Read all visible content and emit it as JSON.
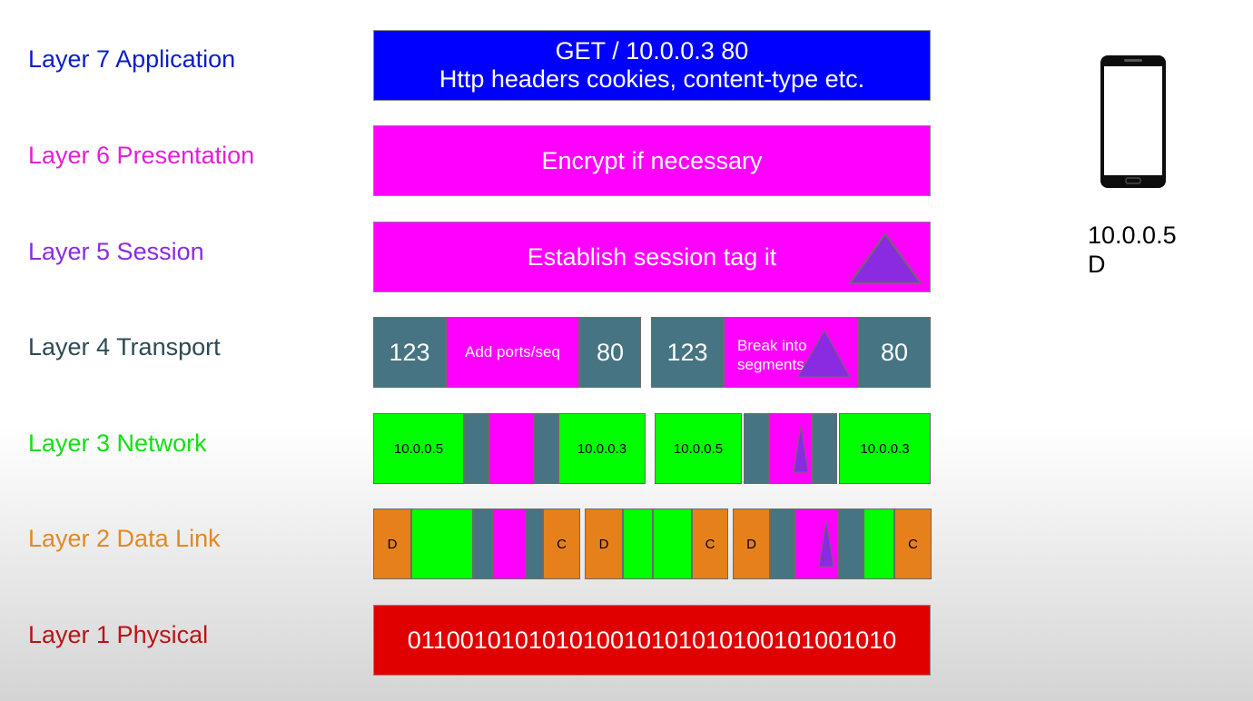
{
  "layers": [
    {
      "label": "Layer 7 Application",
      "color": "#0a1ec8"
    },
    {
      "label": "Layer 6 Presentation",
      "color": "#e41fd6"
    },
    {
      "label": "Layer 5 Session",
      "color": "#8a2be2"
    },
    {
      "label": "Layer 4 Transport",
      "color": "#2c4a55"
    },
    {
      "label": "Layer 3 Network",
      "color": "#14e014"
    },
    {
      "label": "Layer 2 Data Link",
      "color": "#e08a22"
    },
    {
      "label": "Layer 1 Physical",
      "color": "#b81414"
    }
  ],
  "l7": {
    "line1": "GET / 10.0.0.3 80",
    "line2": "Http headers cookies, content-type etc.",
    "color": "#0000ff"
  },
  "l6": {
    "text": "Encrypt if necessary",
    "color": "#ff00ff"
  },
  "l5": {
    "text": "Establish session tag it"
  },
  "l4": {
    "seg1": {
      "src_port": "123",
      "middle": "Add ports/seq",
      "dst_port": "80"
    },
    "seg2": {
      "src_port": "123",
      "middle": "Break into segments",
      "dst_port": "80"
    }
  },
  "l3": {
    "pkt1": {
      "src_ip": "10.0.0.5",
      "dst_ip": "10.0.0.3"
    },
    "pkt2": {
      "src_ip": "10.0.0.5",
      "dst_ip": "10.0.0.3"
    }
  },
  "l2": {
    "frames": [
      {
        "dst": "D",
        "src": "C"
      },
      {
        "dst": "D",
        "src": "C"
      },
      {
        "dst": "D",
        "src": "C"
      }
    ]
  },
  "l1": {
    "bits": "0110010101010100101010101001010010 10",
    "color": "#e00000"
  },
  "device": {
    "icon": "smartphone-icon",
    "ip": "10.0.0.5",
    "mac": "D"
  },
  "tag_color": "#8a2be2"
}
